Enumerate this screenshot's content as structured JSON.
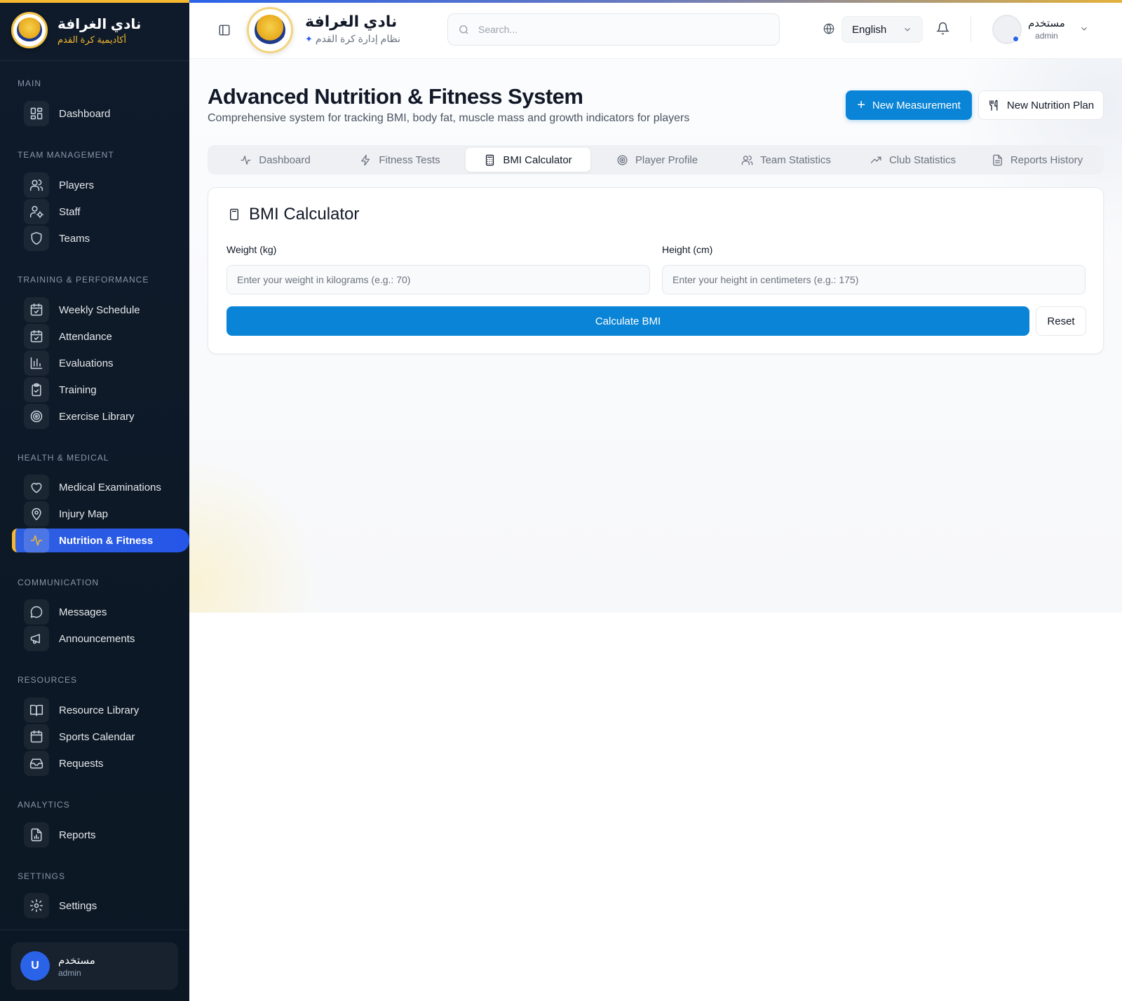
{
  "brand": {
    "name": "نادي الغرافة",
    "sidebar_subtitle": "أكاديمية كرة القدم",
    "header_subtitle": "نظام إدارة كرة القدم"
  },
  "sidebar": {
    "sections": {
      "main": "MAIN",
      "team": "TEAM MANAGEMENT",
      "training": "TRAINING & PERFORMANCE",
      "health": "HEALTH & MEDICAL",
      "communication": "COMMUNICATION",
      "resources": "RESOURCES",
      "analytics": "ANALYTICS",
      "settings": "SETTINGS"
    },
    "items": {
      "dashboard": "Dashboard",
      "players": "Players",
      "staff": "Staff",
      "teams": "Teams",
      "weekly_schedule": "Weekly Schedule",
      "attendance": "Attendance",
      "evaluations": "Evaluations",
      "training": "Training",
      "exercise_library": "Exercise Library",
      "medical_examinations": "Medical Examinations",
      "injury_map": "Injury Map",
      "nutrition_fitness": "Nutrition & Fitness",
      "messages": "Messages",
      "announcements": "Announcements",
      "resource_library": "Resource Library",
      "sports_calendar": "Sports Calendar",
      "requests": "Requests",
      "reports": "Reports",
      "settings": "Settings"
    },
    "active_item": "nutrition_fitness",
    "user": {
      "initial": "U",
      "name": "مستخدم",
      "role": "admin"
    }
  },
  "header": {
    "search_placeholder": "Search...",
    "language": "English",
    "user": {
      "name": "مستخدم",
      "role": "admin"
    }
  },
  "page": {
    "title": "Advanced Nutrition & Fitness System",
    "subtitle": "Comprehensive system for tracking BMI, body fat, muscle mass and growth indicators for players",
    "new_measurement": "New Measurement",
    "new_nutrition_plan": "New Nutrition Plan",
    "tabs": [
      "Dashboard",
      "Fitness Tests",
      "BMI Calculator",
      "Player Profile",
      "Team Statistics",
      "Club Statistics",
      "Reports History"
    ],
    "active_tab": "BMI Calculator"
  },
  "bmi": {
    "title": "BMI Calculator",
    "weight_label": "Weight (kg)",
    "weight_placeholder": "Enter your weight in kilograms (e.g.: 70)",
    "weight_value": "",
    "height_label": "Height (cm)",
    "height_placeholder": "Enter your height in centimeters (e.g.: 175)",
    "height_value": "",
    "calculate": "Calculate BMI",
    "reset": "Reset"
  },
  "colors": {
    "accent": "#0a84d6",
    "sidebar_bg": "#0f1b2b",
    "active_item": "#2b63e8",
    "gold": "#f5b82e"
  }
}
